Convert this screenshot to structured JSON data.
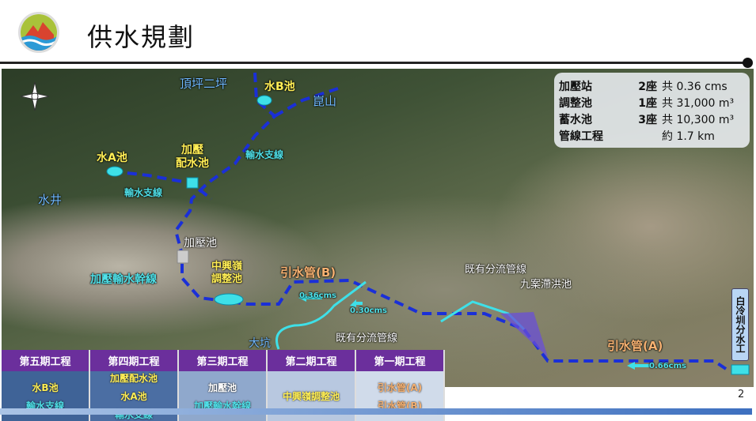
{
  "header": {
    "title": "供水規劃",
    "page_number": "2"
  },
  "summary": [
    {
      "item": "加壓站",
      "count": "2座",
      "value": "共 0.36 cms"
    },
    {
      "item": "調整池",
      "count": "1座",
      "value": "共 31,000 m³"
    },
    {
      "item": "蓄水池",
      "count": "3座",
      "value": "共 10,300 m³"
    },
    {
      "item": "管線工程",
      "count": "",
      "value": "約 1.7  km"
    }
  ],
  "map_labels": {
    "dingping": "頂坪二坪",
    "poolB": "水B池",
    "kunshan": "崑山",
    "branch1": "輸水支線",
    "poolA": "水A池",
    "booster_dist": "加壓\n配水池",
    "branch2": "輸水支線",
    "shuijing": "水井",
    "booster_pool": "加壓池",
    "main_line": "加壓輸水幹線",
    "regulating": "中興嶺\n調整池",
    "pipeB": "引水管(B)",
    "flow1": "0.36cms",
    "flow2": "0.30cms",
    "existing1": "既有分流管線",
    "detention": "九案滯洪池",
    "existing2": "既有分流管線",
    "dakeng": "大坑",
    "pipeA": "引水管(A)",
    "flow3": "0.66cms",
    "baileng": "白冷圳分水工"
  },
  "phases": [
    {
      "header": "第五期工程",
      "items": [
        {
          "t": "水B池",
          "c": "#ffee55"
        },
        {
          "t": "輸水支線",
          "c": "#4fe0e8"
        }
      ],
      "bg": "#3f6397"
    },
    {
      "header": "第四期工程",
      "items": [
        {
          "t": "加壓配水池",
          "c": "#ffee55"
        },
        {
          "t": "水A池",
          "c": "#ffee55"
        },
        {
          "t": "輸水支線",
          "c": "#4fe0e8"
        }
      ],
      "bg": "#4b6ea3"
    },
    {
      "header": "第三期工程",
      "items": [
        {
          "t": "加壓池",
          "c": "#ffffff"
        },
        {
          "t": "加壓輸水幹線",
          "c": "#4fe0e8"
        }
      ],
      "bg": "#8fa8cc"
    },
    {
      "header": "第二期工程",
      "items": [
        {
          "t": "中興嶺調整池",
          "c": "#ffee55"
        }
      ],
      "bg": "#b8c8e0"
    },
    {
      "header": "第一期工程",
      "items": [
        {
          "t": "引水管(A)",
          "c": "#f5b070"
        },
        {
          "t": "引水管(B)",
          "c": "#f5b070"
        }
      ],
      "bg": "#d0dbea"
    }
  ],
  "colors": {
    "route": "#1a2fd8",
    "existing": "#3ee0e8",
    "phase_header": "#6b2f9c"
  }
}
